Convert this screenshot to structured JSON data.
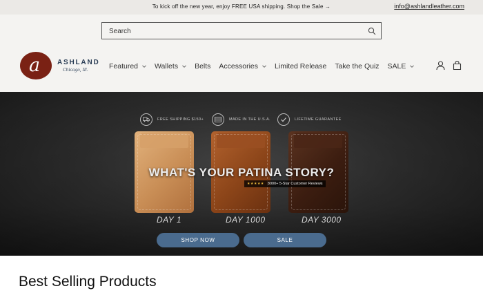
{
  "announcement": {
    "text": "To kick off the new year, enjoy FREE USA shipping. Shop the Sale →",
    "email": "info@ashlandleather.com"
  },
  "search": {
    "placeholder": "Search"
  },
  "logo": {
    "name": "ASHLAND",
    "subtitle": "Chicago, Ill.",
    "mark": "a",
    "brand_color": "#7a2114",
    "text_color": "#2b3e56"
  },
  "nav": {
    "items": [
      {
        "label": "Featured",
        "dropdown": true
      },
      {
        "label": "Wallets",
        "dropdown": true
      },
      {
        "label": "Belts",
        "dropdown": false
      },
      {
        "label": "Accessories",
        "dropdown": true
      },
      {
        "label": "Limited Release",
        "dropdown": false
      },
      {
        "label": "Take the Quiz",
        "dropdown": false
      },
      {
        "label": "SALE",
        "dropdown": true
      }
    ]
  },
  "header_icons": [
    "account-icon",
    "cart-icon"
  ],
  "hero": {
    "badges": [
      {
        "icon": "truck-icon",
        "text": "FREE SHIPPING $150+"
      },
      {
        "icon": "usa-icon",
        "text": "MADE IN THE U.S.A."
      },
      {
        "icon": "checkmark-icon",
        "text": "LIFETIME GUARANTEE"
      }
    ],
    "headline": "WHAT'S YOUR PATINA STORY?",
    "rating_stars": "★★★★★",
    "reviews": "8000+ 5-Star Customer Reviews",
    "days": [
      "DAY 1",
      "DAY 1000",
      "DAY 3000"
    ],
    "buttons": {
      "shop": "SHOP NOW",
      "sale": "SALE"
    },
    "button_color": "#4a6b8e"
  },
  "products": {
    "title": "Best Selling Products"
  }
}
